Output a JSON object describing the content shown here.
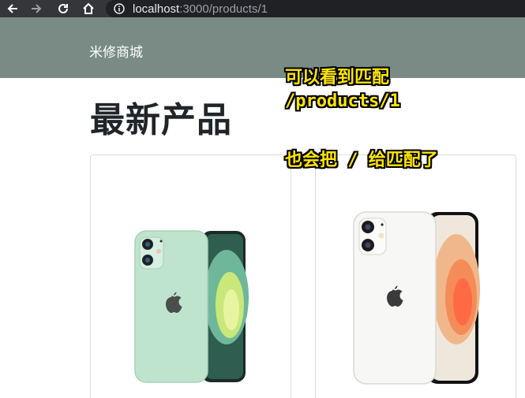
{
  "browser": {
    "url_host": "localhost",
    "url_path": ":3000/products/1",
    "icons": [
      "back-arrow-icon",
      "forward-arrow-icon",
      "reload-icon",
      "home-icon",
      "info-icon"
    ]
  },
  "header": {
    "brand": "米修商城"
  },
  "main": {
    "title": "最新产品",
    "products": [
      {
        "image": "green-iphone-12"
      },
      {
        "image": "white-iphone-12"
      }
    ]
  },
  "annotation": {
    "line1": "可以看到匹配",
    "line2": "/products/1",
    "line3": "也会把 / 给匹配了"
  },
  "colors": {
    "header_bg": "#7a8b86",
    "annotation_text": "#ffe600"
  }
}
